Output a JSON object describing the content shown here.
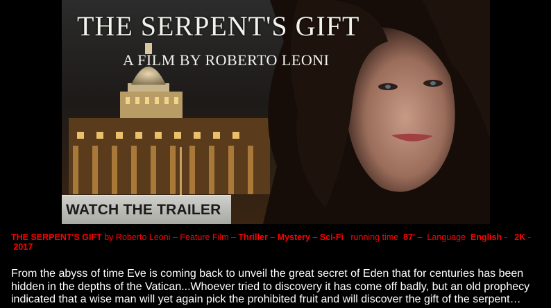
{
  "poster": {
    "title": "THE SERPENT'S GIFT",
    "byline": "A FILM BY ROBERTO LEONI",
    "trailer_button": "WATCH THE TRAILER"
  },
  "info": {
    "title": "THE SERPENT'S GIFT",
    "director": "by Roberto Leoni",
    "sep1": "–",
    "type": "Feature Film",
    "sep2": "–",
    "genre1": "Thriller",
    "sep3": "–",
    "genre2": "Mystery",
    "sep4": "–",
    "genre3": "Sci-Fi",
    "running_label": "running time",
    "running_value": "87'",
    "sep5": "–",
    "language_label": "Language",
    "language_value": "English",
    "sep6": "-",
    "format": "2K",
    "sep7": "-",
    "year": "2017"
  },
  "synopsis": "From the abyss of time Eve is coming back to unveil the great secret of Eden that for centuries has been hidden in the depths of the Vatican...Whoever tried to discovery it has come off badly, but an old prophecy indicated that a wise man will yet again pick the prohibited fruit and will discover the gift of the serpent…",
  "colors": {
    "background": "#000000",
    "info_text": "#ff0000",
    "synopsis_text": "#ffffff"
  },
  "icons": [
    "serpent-letter-icon"
  ]
}
